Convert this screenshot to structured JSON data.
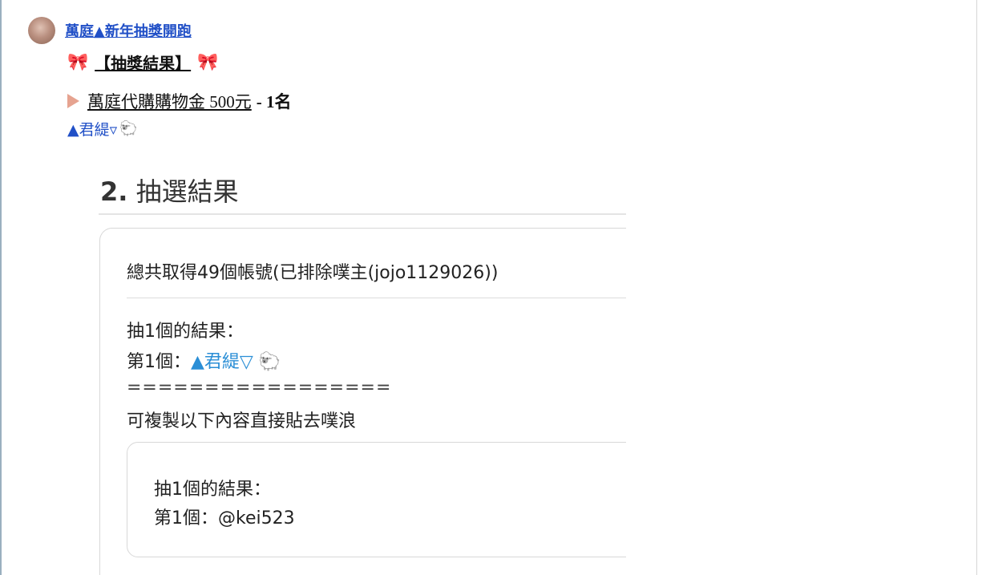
{
  "post": {
    "author": "萬庭▲新年抽獎開跑",
    "title_bow": "🎀",
    "title": "【抽獎結果】",
    "prize_link": "萬庭代購購物金 500元",
    "prize_count": "- 1名",
    "winner": "▲君緹▿",
    "winner_icon": "🐑"
  },
  "screenshot": {
    "section_number": "2.",
    "section_title": "抽選結果",
    "total_accounts": "總共取得49個帳號(已排除噗主(jojo1129026))",
    "draw_heading": "抽1個的結果：",
    "first_label": "第1個：",
    "first_winner": "▲君緹▽",
    "first_winner_icon": "🐑",
    "separator": "=================",
    "copy_hint": "可複製以下內容直接貼去噗浪",
    "copy_box": {
      "heading": "抽1個的結果：",
      "first_label": "第1個：",
      "first_handle": "@kei523"
    }
  }
}
